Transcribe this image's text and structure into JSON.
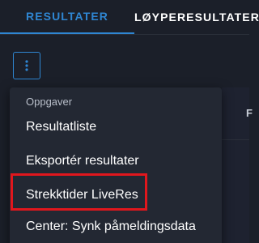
{
  "tabs": [
    {
      "label": "RESULTATER",
      "active": true
    },
    {
      "label": "LØYPERESULTATER",
      "active": false
    }
  ],
  "menu": {
    "header": "Oppgaver",
    "items": [
      {
        "label": "Resultatliste"
      },
      {
        "label": "Eksportér resultater"
      },
      {
        "label": "Strekktider LiveRes",
        "highlighted": true
      },
      {
        "label": "Center: Synk påmeldingsdata"
      }
    ]
  },
  "right_panel": {
    "glyph": "F"
  },
  "icons": {
    "kebab": "more-vertical-icon"
  },
  "colors": {
    "background": "#1b1f29",
    "accent": "#2f86d2",
    "menu_background": "#232833",
    "highlight_box": "#e1171d"
  }
}
